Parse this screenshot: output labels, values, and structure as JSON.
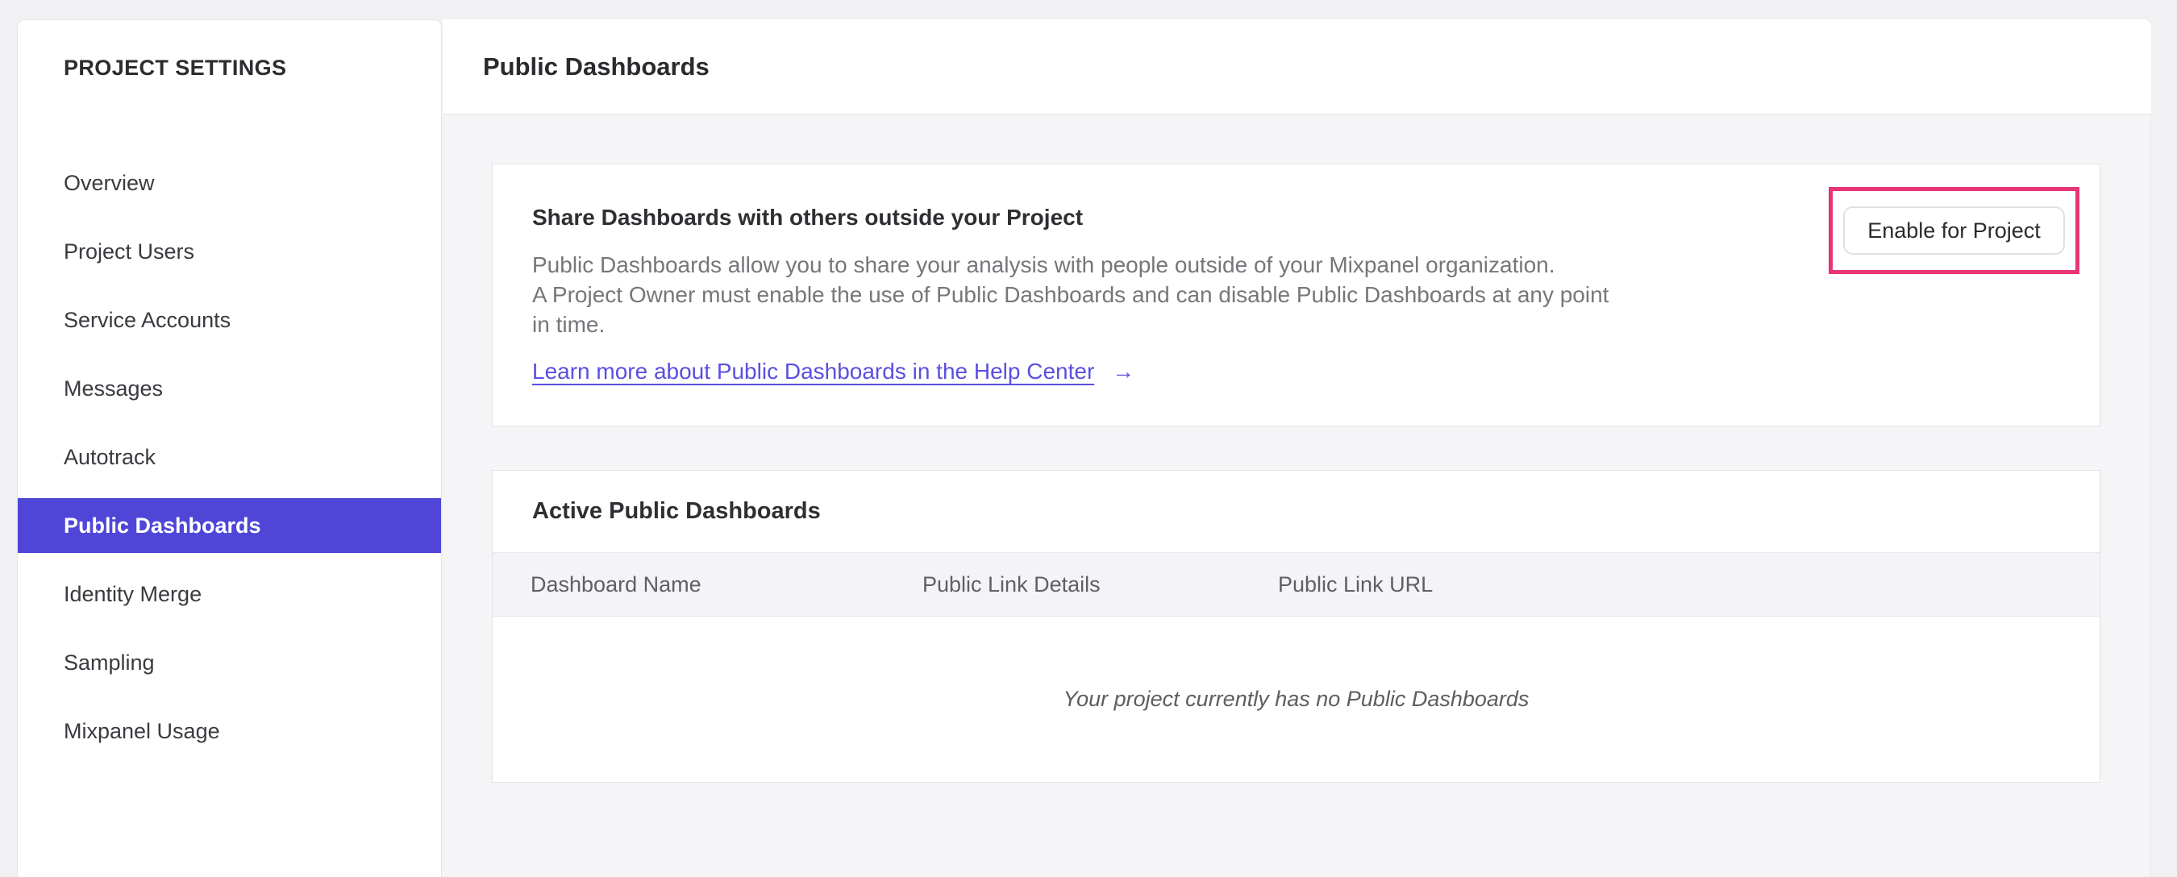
{
  "sidebar": {
    "header": "PROJECT SETTINGS",
    "items": [
      {
        "label": "Overview",
        "selected": false
      },
      {
        "label": "Project Users",
        "selected": false
      },
      {
        "label": "Service Accounts",
        "selected": false
      },
      {
        "label": "Messages",
        "selected": false
      },
      {
        "label": "Autotrack",
        "selected": false
      },
      {
        "label": "Public Dashboards",
        "selected": true
      },
      {
        "label": "Identity Merge",
        "selected": false
      },
      {
        "label": "Sampling",
        "selected": false
      },
      {
        "label": "Mixpanel Usage",
        "selected": false
      }
    ]
  },
  "header": {
    "title": "Public Dashboards"
  },
  "share_card": {
    "title": "Share Dashboards with others outside your Project",
    "description_lines": [
      "Public Dashboards allow you to share your analysis with people outside of your Mixpanel organization.",
      "A Project Owner must enable the use of Public Dashboards and can disable Public Dashboards at any point",
      "in time."
    ],
    "link_label": "Learn more about Public Dashboards in the Help Center",
    "link_arrow": "→",
    "button_label": "Enable for Project"
  },
  "active_card": {
    "title": "Active Public Dashboards",
    "columns": [
      "Dashboard Name",
      "Public Link Details",
      "Public Link URL"
    ],
    "empty_message": "Your project currently has no Public Dashboards"
  },
  "colors": {
    "accent_purple": "#4f46d8",
    "link_purple": "#5a4fe0",
    "highlight_pink": "#e73577"
  }
}
